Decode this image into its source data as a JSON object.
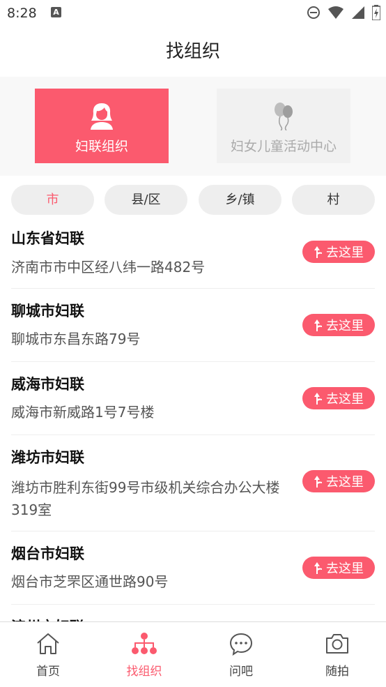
{
  "status_bar": {
    "time": "8:28",
    "notification_letter": "A"
  },
  "header": {
    "title": "找组织"
  },
  "org_types": [
    {
      "label": "妇联组织",
      "icon": "woman-icon",
      "active": true
    },
    {
      "label": "妇女儿童活动中心",
      "icon": "balloons-icon",
      "active": false
    }
  ],
  "tabs": [
    {
      "label": "市",
      "active": true
    },
    {
      "label": "县/区",
      "active": false
    },
    {
      "label": "乡/镇",
      "active": false
    },
    {
      "label": "村",
      "active": false
    }
  ],
  "go_label": "去这里",
  "orgs": [
    {
      "name": "山东省妇联",
      "address": "济南市市中区经八纬一路482号"
    },
    {
      "name": "聊城市妇联",
      "address": "聊城市东昌东路79号"
    },
    {
      "name": "威海市妇联",
      "address": "威海市新威路1号7号楼"
    },
    {
      "name": "潍坊市妇联",
      "address": "潍坊市胜利东街99号市级机关综合办公大楼319室"
    },
    {
      "name": "烟台市妇联",
      "address": "烟台市芝罘区通世路90号"
    },
    {
      "name": "滨州市妇联",
      "address": ""
    }
  ],
  "bottom_tabs": [
    {
      "label": "首页",
      "icon": "home-icon",
      "active": false
    },
    {
      "label": "找组织",
      "icon": "org-tree-icon",
      "active": true
    },
    {
      "label": "问吧",
      "icon": "chat-bubble-icon",
      "active": false
    },
    {
      "label": "随拍",
      "icon": "camera-icon",
      "active": false
    }
  ],
  "colors": {
    "accent": "#fb5a6e"
  }
}
